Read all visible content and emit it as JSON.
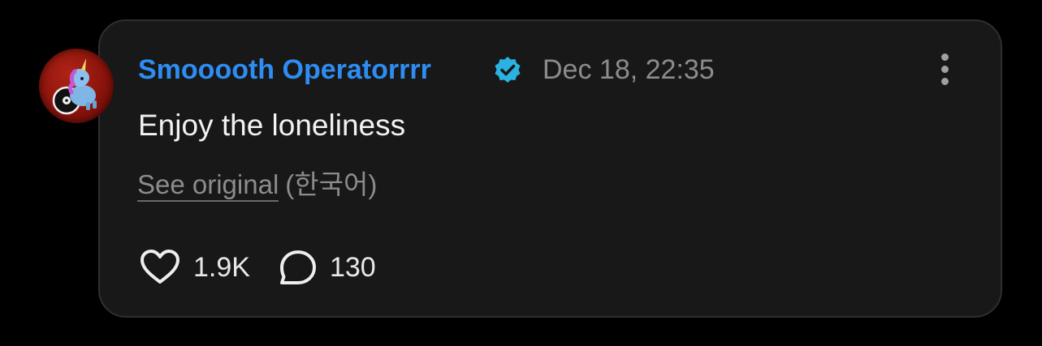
{
  "post": {
    "author": "Smooooth Operatorrrr",
    "verified_icon": "verified-badge-icon",
    "timestamp": "Dec 18, 22:35",
    "text": "Enjoy the loneliness",
    "see_original_label": "See original",
    "original_language": "(한국어)",
    "likes": "1.9K",
    "replies": "130"
  },
  "icons": {
    "like": "heart-icon",
    "reply": "speech-bubble-icon",
    "menu": "more-vertical-icon"
  },
  "colors": {
    "background": "#000000",
    "card": "#181818",
    "author": "#2d8df2",
    "verified": "#2ab3e0",
    "muted": "#8c8c8c",
    "text": "#f2f2f2"
  }
}
